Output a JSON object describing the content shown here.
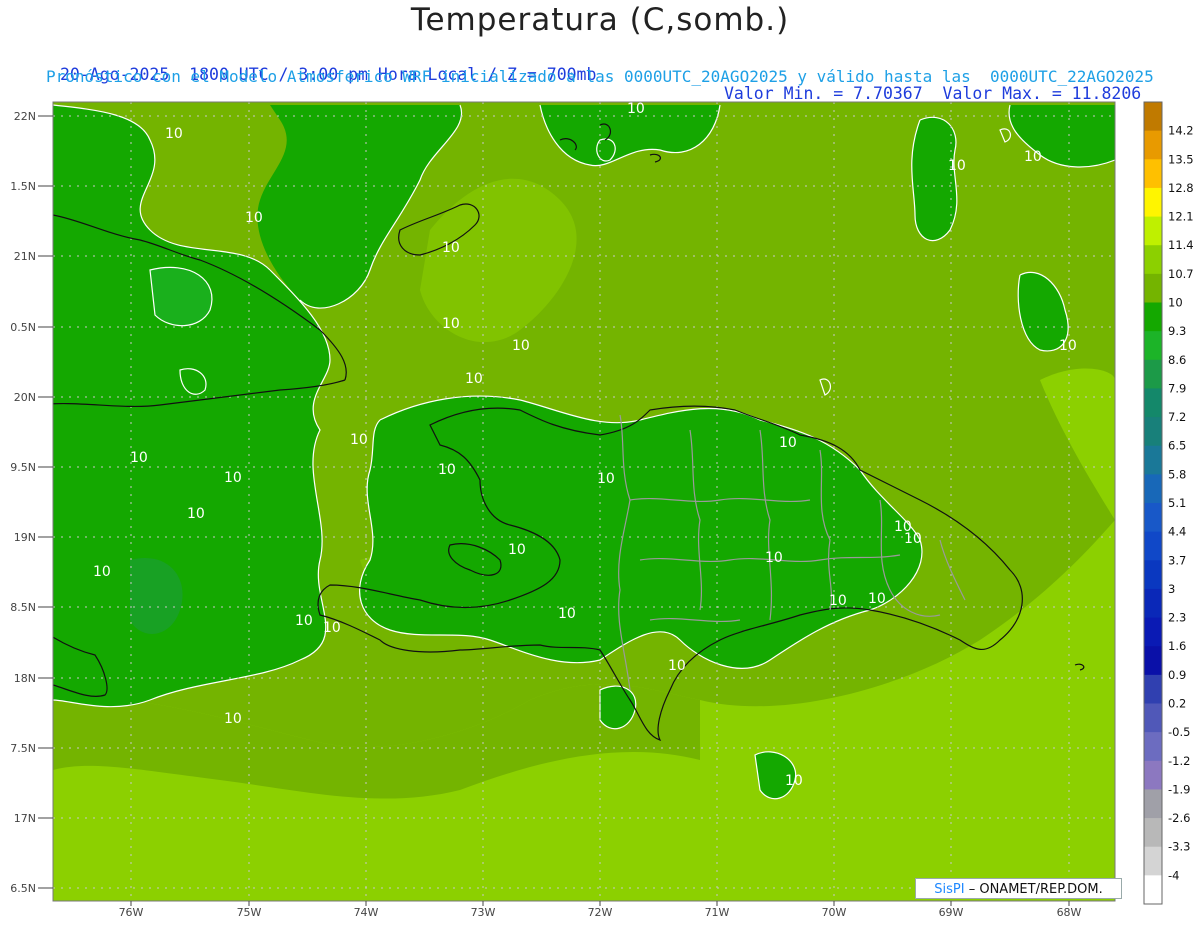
{
  "header": {
    "title": "Temperatura (C,somb.)",
    "datetime_line": "20-Ago-2025  1800 UTC / 3:00 pm Hora Local / Z = 700mb",
    "min_max_line": "Valor Min. = 7.70367  Valor Max. = 11.8206",
    "model_line": "Pronóstico con el Modelo Atmosferico WRF inicializado a las 0000UTC_20AGO2025 y válido hasta las  0000UTC_22AGO2025"
  },
  "axes": {
    "lat_labels": [
      "22N",
      "1.5N",
      "21N",
      "0.5N",
      "20N",
      "9.5N",
      "19N",
      "8.5N",
      "18N",
      "7.5N",
      "17N",
      "6.5N"
    ],
    "lon_labels": [
      "76W",
      "75W",
      "74W",
      "73W",
      "72W",
      "71W",
      "70W",
      "69W",
      "68W"
    ]
  },
  "contour_label": "10",
  "colorbar": {
    "labels": [
      "14.2",
      "13.5",
      "12.8",
      "12.1",
      "11.4",
      "10.7",
      "10",
      "9.3",
      "8.6",
      "7.9",
      "7.2",
      "6.5",
      "5.8",
      "5.1",
      "4.4",
      "3.7",
      "3",
      "2.3",
      "1.6",
      "0.9",
      "0.2",
      "-0.5",
      "-1.2",
      "-1.9",
      "-2.6",
      "-3.3",
      "-4"
    ],
    "colors": [
      "#c07a00",
      "#e89a00",
      "#ffc000",
      "#fff500",
      "#bff000",
      "#8cd000",
      "#74b400",
      "#14a800",
      "#1cb428",
      "#1c9a48",
      "#14886a",
      "#18807a",
      "#1a7898",
      "#1868b8",
      "#1858c8",
      "#1048c8",
      "#0a38c0",
      "#0a28b8",
      "#0a1ab4",
      "#0a10a8",
      "#3040b0",
      "#5058b8",
      "#6c6cc0",
      "#8c78c0",
      "#a0a0a8",
      "#b8b8b8",
      "#d4d4d4",
      "#ffffff"
    ]
  },
  "credit": {
    "brand": "SisPI",
    "text": " – ONAMET/REP.DOM."
  }
}
